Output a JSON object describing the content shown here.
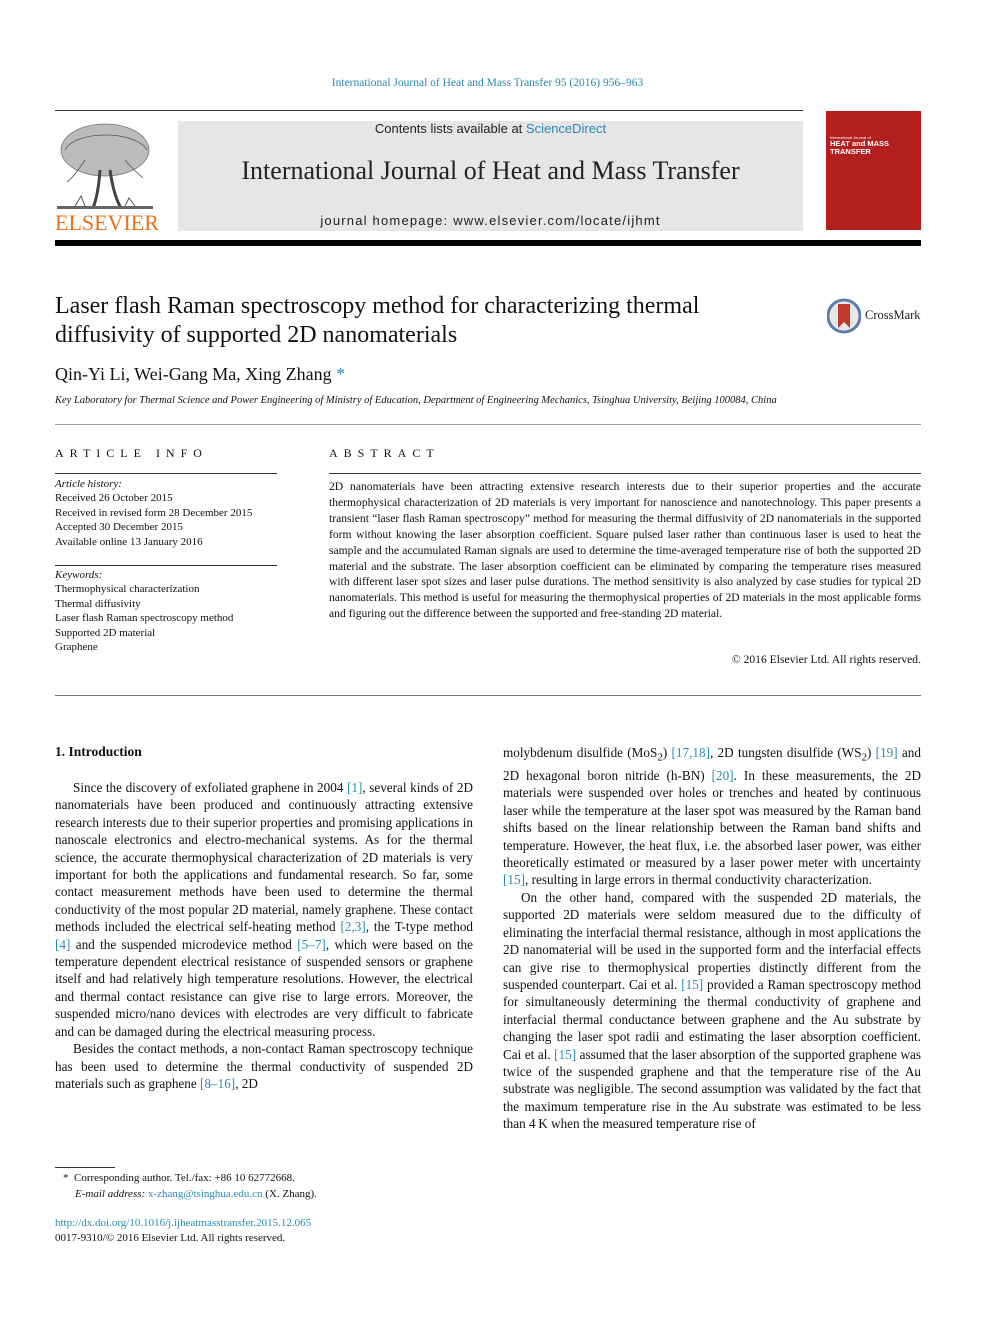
{
  "header": {
    "journal_ref": "International Journal of Heat and Mass Transfer 95 (2016) 956–963",
    "contents_prefix": "Contents lists available at ",
    "contents_link": "ScienceDirect",
    "journal_title": "International Journal of Heat and Mass Transfer",
    "homepage": "journal homepage: www.elsevier.com/locate/ijhmt",
    "publisher": "ELSEVIER",
    "cover": {
      "line1": "International Journal of",
      "line2": "HEAT and MASS",
      "line3": "TRANSFER",
      "color": "#b31f1f"
    },
    "publisher_color": "#e8731a"
  },
  "article": {
    "title": "Laser flash Raman spectroscopy method for characterizing thermal diffusivity of supported 2D nanomaterials",
    "crossmark": "CrossMark",
    "authors": "Qin-Yi Li, Wei-Gang Ma, Xing Zhang",
    "author_marker": "*",
    "affiliation": "Key Laboratory for Thermal Science and Power Engineering of Ministry of Education, Department of Engineering Mechanics, Tsinghua University, Beijing 100084, China"
  },
  "article_info": {
    "heading": "ARTICLE INFO",
    "history_label": "Article history:",
    "history": [
      "Received 26 October 2015",
      "Received in revised form 28 December 2015",
      "Accepted 30 December 2015",
      "Available online 13 January 2016"
    ],
    "keywords_label": "Keywords:",
    "keywords": [
      "Thermophysical characterization",
      "Thermal diffusivity",
      "Laser flash Raman spectroscopy method",
      "Supported 2D material",
      "Graphene"
    ]
  },
  "abstract": {
    "heading": "ABSTRACT",
    "text": "2D nanomaterials have been attracting extensive research interests due to their superior properties and the accurate thermophysical characterization of 2D materials is very important for nanoscience and nanotechnology. This paper presents a transient “laser flash Raman spectroscopy” method for measuring the thermal diffusivity of 2D nanomaterials in the supported form without knowing the laser absorption coefficient. Square pulsed laser rather than continuous laser is used to heat the sample and the accumu­lated Raman signals are used to determine the time-averaged temperature rise of both the supported 2D material and the substrate. The laser absorption coefficient can be eliminated by comparing the temper­ature rises measured with different laser spot sizes and laser pulse durations. The method sensitivity is also analyzed by case studies for typical 2D nanomaterials. This method is useful for measuring the thermophysical properties of 2D materials in the most applicable forms and figuring out the difference between the supported and free-standing 2D material.",
    "copyright": "© 2016 Elsevier Ltd. All rights reserved."
  },
  "body": {
    "section_title": "1. Introduction",
    "left_p1": [
      "Since the discovery of exfoliated graphene in 2004 ",
      "[1]",
      ", several kinds of 2D nanomaterials have been produced and continuously attracting extensive research interests due to their superior properties and promising applications in nanoscale electronics and electro-mechanical systems. As for the thermal science, the accurate thermophysical characterization of 2D materials is very important for both the applications and fundamental research. So far, some contact measurement methods have been used to determine the thermal conductivity of the most popular 2D material, namely graphene. These contact methods included the electrical self-heating method ",
      "[2,3]",
      ", the T-type method ",
      "[4]",
      " and the suspended microdevice method ",
      "[5–7]",
      ", which were based on the temperature dependent electrical resistance of suspended sensors or graphene itself and had relatively high temperature resolutions. However, the electrical and thermal contact resistance can give rise to large errors. Moreover, the suspended micro/nano devices with electrodes are very difficult to fabricate and can be damaged during the electrical measuring process."
    ],
    "left_p2": [
      "Besides the contact methods, a non-contact Raman spectroscopy technique has been used to determine the thermal conductivity of suspended 2D materials such as graphene ",
      "[8–16]",
      ", 2D"
    ],
    "right_p1": [
      "molybdenum disulfide (MoS",
      "2",
      ") ",
      "[17,18]",
      ", 2D tungsten disulfide (WS",
      "2",
      ") ",
      "[19]",
      " and 2D hexagonal boron nitride (h-BN) ",
      "[20]",
      ". In these measurements, the 2D materials were suspended over holes or trenches and heated by continuous laser while the temperature at the laser spot was measured by the Raman band shifts based on the linear relationship between the Raman band shifts and temperature. However, the heat flux, i.e. the absorbed laser power, was either theoretically estimated or measured by a laser power meter with uncertainty ",
      "[15]",
      ", resulting in large errors in thermal conductivity characterization."
    ],
    "right_p2": [
      "On the other hand, compared with the suspended 2D materials, the supported 2D materials were seldom measured due to the difficulty of eliminating the interfacial thermal resistance, although in most applications the 2D nanomaterial will be used in the supported form and the interfacial effects can give rise to thermophysical properties distinctly different from the suspended counterpart. Cai et al. ",
      "[15]",
      " provided a Raman spectroscopy method for simultaneously determining the thermal conductivity of graphene and interfacial thermal conductance between graphene and the Au substrate by changing the laser spot radii and estimating the laser absorption coefficient. Cai et al. ",
      "[15]",
      " assumed that the laser absorption of the supported graphene was twice of the suspended graphene and that the temperature rise of the Au substrate was negligible. The second assumption was validated by the fact that the maximum temperature rise in the Au substrate was estimated to be less than 4 K when the measured temperature rise of"
    ]
  },
  "footnote": {
    "marker": "*",
    "corresponding": "Corresponding author. Tel./fax: +86 10 62772668.",
    "email_label": "E-mail address:",
    "email": "x-zhang@tsinghua.edu.cn",
    "email_suffix": " (X. Zhang).",
    "doi": "http://dx.doi.org/10.1016/j.ijheatmasstransfer.2015.12.065",
    "issn": "0017-9310/© 2016 Elsevier Ltd. All rights reserved."
  },
  "colors": {
    "link": "#2a8ab0",
    "banner_bg": "#e6e6e6"
  }
}
